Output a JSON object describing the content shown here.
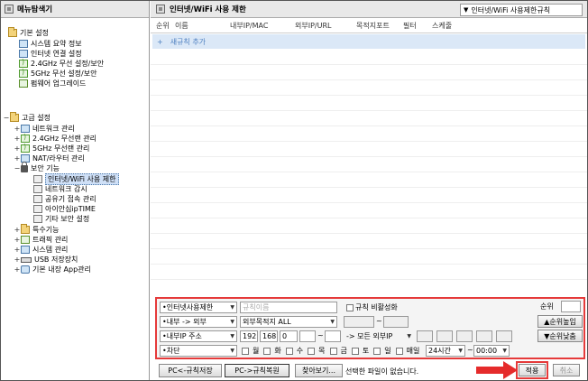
{
  "left": {
    "title": "메뉴탐색기",
    "basic": {
      "title": "기본 설정",
      "items": [
        "시스템 요약 정보",
        "인터넷 연결 설정",
        "2.4GHz 무선 설정/보안",
        "5GHz 무선 설정/보안",
        "펌웨어 업그레이드"
      ]
    },
    "advanced": {
      "title": "고급 설정",
      "items": [
        "네트워크 관리",
        "2.4GHz 무선랜 관리",
        "5GHz 무선랜 관리",
        "NAT/라우터 관리",
        "보안 기능"
      ],
      "security_items": [
        "인터넷/WiFi 사용 제한",
        "네트워크 감시",
        "공유기 접속 관리",
        "아이안심ipTIME",
        "기타 보안 설정"
      ],
      "rest_items": [
        "특수기능",
        "트래픽 관리",
        "시스템 관리",
        "USB 저장장치",
        "기본 내장 App관리"
      ]
    }
  },
  "right": {
    "title": "인터넷/WiFi 사용 제한",
    "mode_select": "인터넷/WiFi 사용제한규칙",
    "columns": [
      "순위",
      "이름",
      "내부IP/MAC",
      "외부IP/URL",
      "목적지포트",
      "필터",
      "스케줄"
    ],
    "add_rule": "새규칙 추가",
    "form": {
      "rule_type": "인터넷사용제한",
      "rule_name_placeholder": "규칙이름",
      "disable_label": "규칙 비활성화",
      "priority_label": "순위",
      "direction": "내부 -> 외부",
      "dest_type": "외부목적지 ALL",
      "port_sep": "~",
      "src_type": "내부IP 주소",
      "ip1": "192",
      "ip2": "168",
      "ip3": "0",
      "ip_sep": "~",
      "arrow_label": "-> 모든 외부IP",
      "up_btn": "순위높임",
      "down_btn": "순위낮춤",
      "action": "차단",
      "days": [
        "월",
        "화",
        "수",
        "목",
        "금",
        "토",
        "일",
        "매일"
      ],
      "hours": "24시간",
      "tilde": "~",
      "time": "00:00"
    },
    "bottom": {
      "save_pc": "PC<-규칙저장",
      "restore": "PC->규칙복원",
      "browse": "찾아보기...",
      "file_status": "선택한 파일이 없습니다.",
      "apply": "적용",
      "cancel": "취소"
    }
  }
}
